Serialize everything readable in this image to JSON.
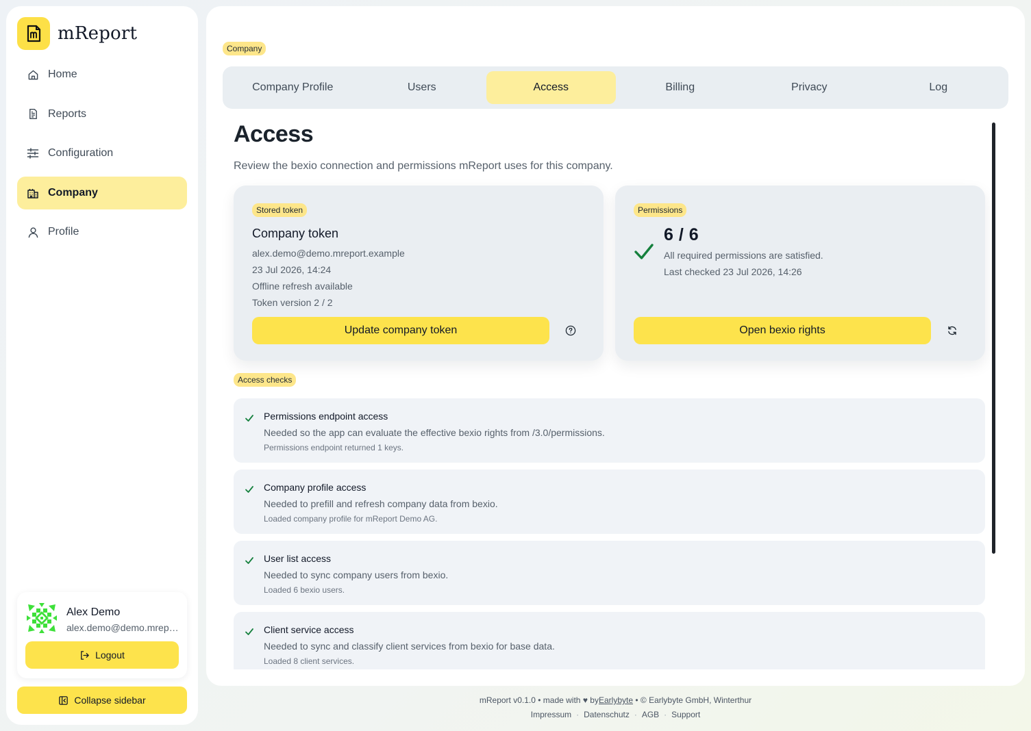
{
  "app": {
    "name": "mReport",
    "accent_color": "#fde047"
  },
  "sidebar": {
    "items": [
      {
        "label": "Home",
        "icon": "home-icon"
      },
      {
        "label": "Reports",
        "icon": "document-icon"
      },
      {
        "label": "Configuration",
        "icon": "sliders-icon"
      },
      {
        "label": "Company",
        "icon": "building-icon",
        "active": true
      },
      {
        "label": "Profile",
        "icon": "user-icon"
      }
    ],
    "user": {
      "name": "Alex Demo",
      "email": "alex.demo@demo.mreport.example",
      "logout_label": "Logout"
    },
    "collapse_label": "Collapse sidebar"
  },
  "main": {
    "breadcrumb": "Company",
    "tabs": [
      {
        "label": "Company Profile"
      },
      {
        "label": "Users"
      },
      {
        "label": "Access",
        "active": true
      },
      {
        "label": "Billing"
      },
      {
        "label": "Privacy"
      },
      {
        "label": "Log"
      }
    ],
    "title": "Access",
    "subtitle": "Review the bexio connection and permissions mReport uses for this company.",
    "token_card": {
      "chip": "Stored token",
      "title": "Company token",
      "email": "alex.demo@demo.mreport.example",
      "date": "23 Jul 2026, 14:24",
      "refresh": "Offline refresh available",
      "version": "Token version 2 / 2",
      "button_label": "Update company token"
    },
    "permissions_card": {
      "chip": "Permissions",
      "count": "6 / 6",
      "status": "All required permissions are satisfied.",
      "last_checked": "Last checked 23 Jul 2026, 14:26",
      "button_label": "Open bexio rights",
      "status_color": "#15803d"
    },
    "checks_chip": "Access checks",
    "checks": [
      {
        "title": "Permissions endpoint access",
        "desc": "Needed so the app can evaluate the effective bexio rights from /3.0/permissions.",
        "note": "Permissions endpoint returned 1 keys."
      },
      {
        "title": "Company profile access",
        "desc": "Needed to prefill and refresh company data from bexio.",
        "note": "Loaded company profile for mReport Demo AG."
      },
      {
        "title": "User list access",
        "desc": "Needed to sync company users from bexio.",
        "note": "Loaded 6 bexio users."
      },
      {
        "title": "Client service access",
        "desc": "Needed to sync and classify client services from bexio for base data.",
        "note": "Loaded 8 client services."
      }
    ]
  },
  "footer": {
    "version_text": "mReport v0.1.0 • made with",
    "by_text": "by",
    "company_link": "Earlybyte",
    "copyright": "• © Earlybyte GmbH, Winterthur",
    "links": [
      "Impressum",
      "Datenschutz",
      "AGB",
      "Support"
    ]
  }
}
